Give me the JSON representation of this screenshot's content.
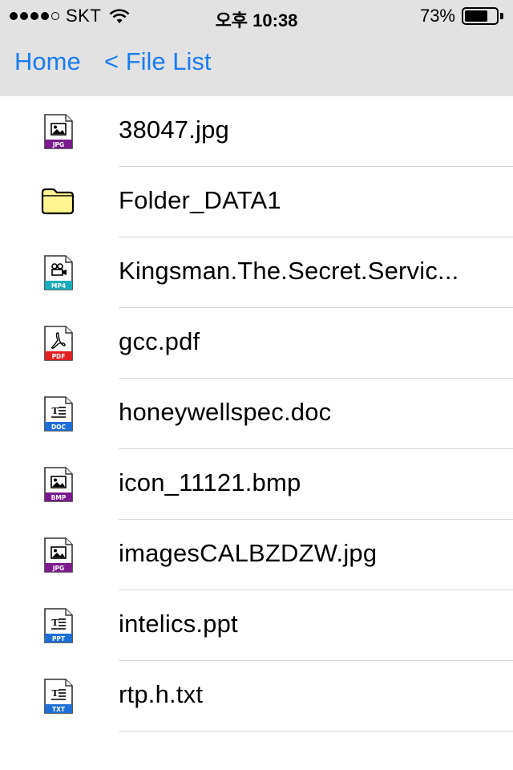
{
  "status_bar": {
    "carrier": "SKT",
    "time": "오후 10:38",
    "battery_percent": "73%",
    "battery_level": 0.73,
    "signal_bars_filled": 4,
    "signal_bars_total": 5
  },
  "nav": {
    "home_label": "Home",
    "back_label": "< File List"
  },
  "files": [
    {
      "name": "38047.jpg",
      "type": "JPG",
      "icon": "image-file-icon",
      "badge_color": "#7b1a8c"
    },
    {
      "name": "Folder_DATA1",
      "type": "folder",
      "icon": "folder-icon",
      "badge_color": "#fff68f"
    },
    {
      "name": "Kingsman.The.Secret.Servic...",
      "type": "MP4",
      "icon": "video-file-icon",
      "badge_color": "#19aebd"
    },
    {
      "name": "gcc.pdf",
      "type": "PDF",
      "icon": "pdf-file-icon",
      "badge_color": "#e02020"
    },
    {
      "name": "honeywellspec.doc",
      "type": "DOC",
      "icon": "document-file-icon",
      "badge_color": "#1e6fd6"
    },
    {
      "name": "icon_11121.bmp",
      "type": "BMP",
      "icon": "image-file-icon",
      "badge_color": "#7b1a8c"
    },
    {
      "name": "imagesCALBZDZW.jpg",
      "type": "JPG",
      "icon": "image-file-icon",
      "badge_color": "#7b1a8c"
    },
    {
      "name": "intelics.ppt",
      "type": "PPT",
      "icon": "document-file-icon",
      "badge_color": "#1e6fd6"
    },
    {
      "name": "rtp.h.txt",
      "type": "TXT",
      "icon": "document-file-icon",
      "badge_color": "#1e6fd6"
    }
  ],
  "colors": {
    "accent": "#1a7cf3",
    "bar_background": "#e2e2e2",
    "separator": "#d6d6d6"
  }
}
